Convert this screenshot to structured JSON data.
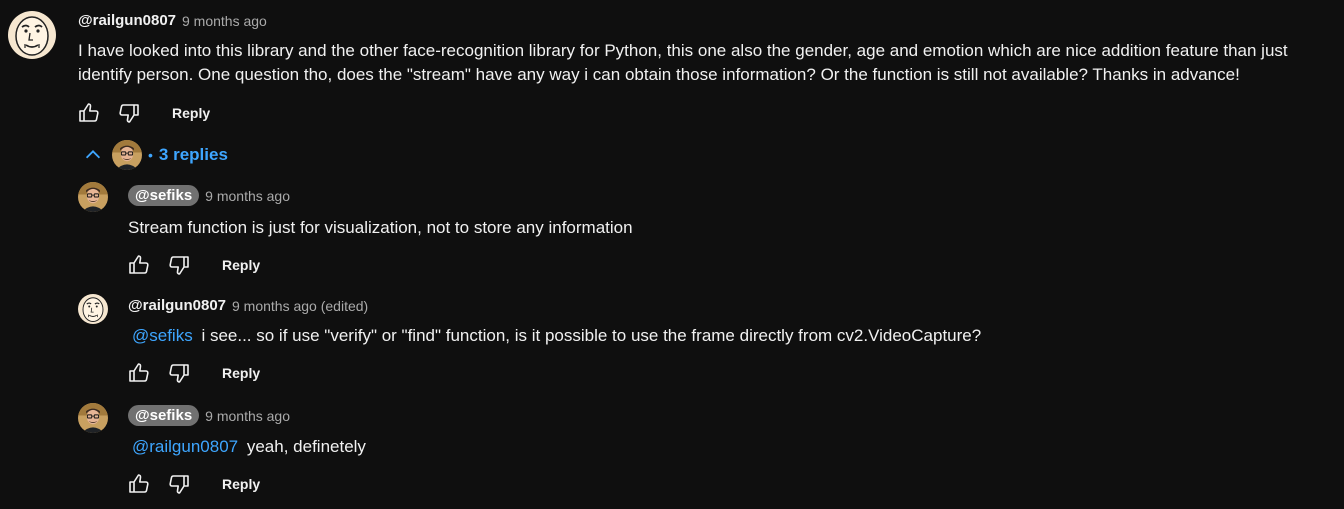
{
  "top_comment": {
    "author": "@railgun0807",
    "time": "9 months ago",
    "text": "I have looked into this library and the other face-recognition library for Python, this one also the gender, age and emotion which are nice addition feature than just identify person. One question tho, does the \"stream\" have any way i can obtain those information? Or the function is still not available? Thanks in advance!",
    "reply_label": "Reply"
  },
  "replies_toggle": {
    "dot": "•",
    "label": "3 replies"
  },
  "replies": [
    {
      "author": "@sefiks",
      "time": "9 months ago",
      "mention": "",
      "text": "Stream function is just for visualization, not to store any information",
      "reply_label": "Reply"
    },
    {
      "author": "@railgun0807",
      "time": "9 months ago (edited)",
      "mention": "@sefiks",
      "text": "i see... so if use \"verify\" or \"find\" function, is it possible to use the frame directly from cv2.VideoCapture?",
      "reply_label": "Reply"
    },
    {
      "author": "@sefiks",
      "time": "9 months ago",
      "mention": "@railgun0807",
      "text": "yeah, definetely",
      "reply_label": "Reply"
    }
  ],
  "icons": [
    "like-icon",
    "dislike-icon",
    "chevron-up-icon"
  ],
  "colors": {
    "background": "#0f0f0f",
    "link": "#3ea6ff",
    "chip": "#717171",
    "secondary_text": "#aaaaaa"
  }
}
